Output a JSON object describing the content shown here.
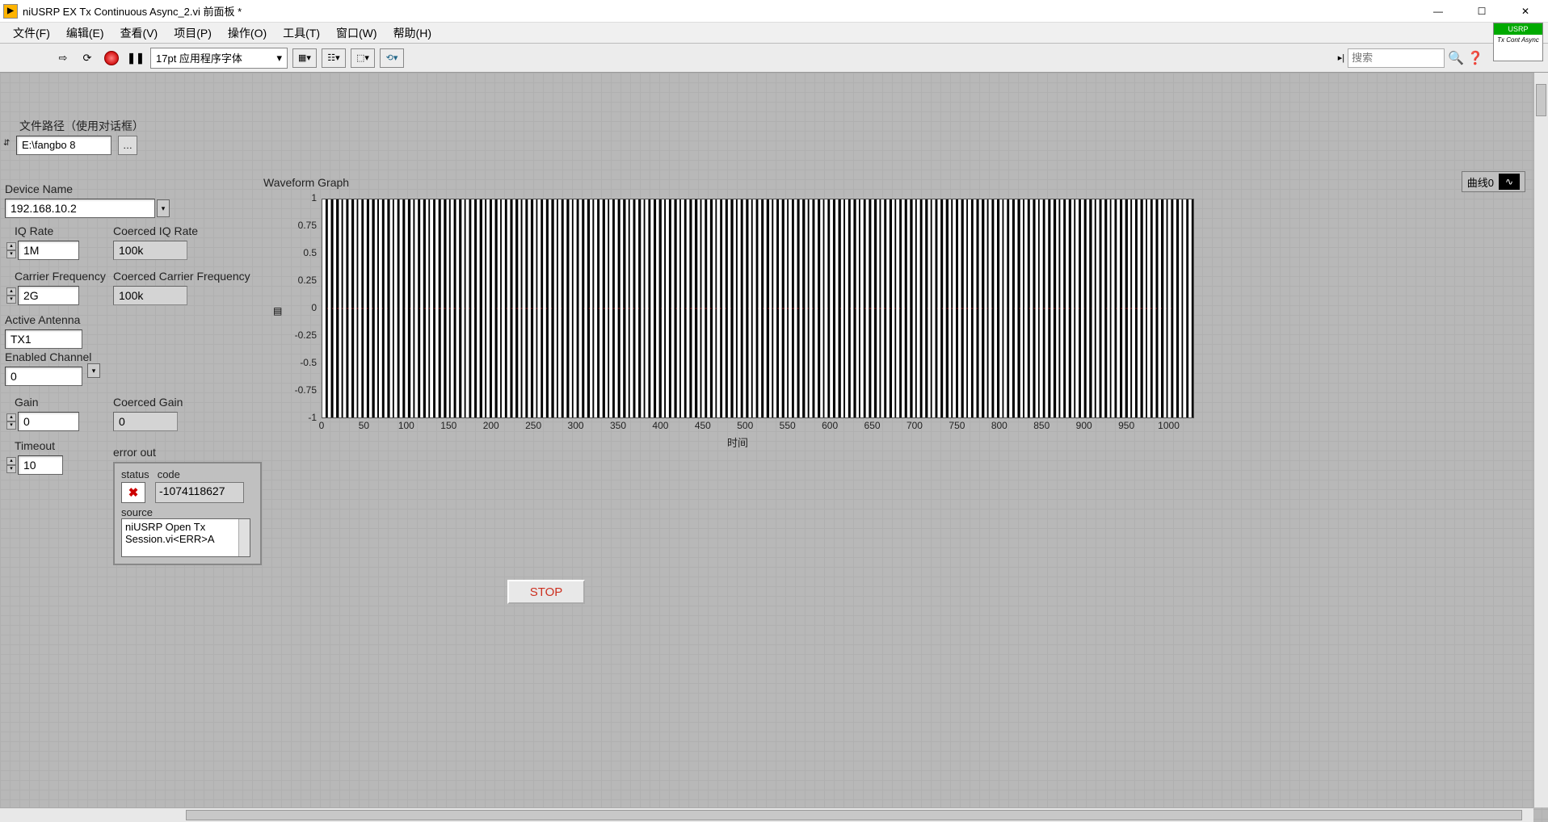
{
  "window": {
    "title": "niUSRP EX Tx Continuous Async_2.vi 前面板 *"
  },
  "menu": {
    "file": "文件(F)",
    "edit": "编辑(E)",
    "view": "查看(V)",
    "project": "项目(P)",
    "operate": "操作(O)",
    "tools": "工具(T)",
    "window": "窗口(W)",
    "help": "帮助(H)"
  },
  "toolbar": {
    "font": "17pt 应用程序字体",
    "search_placeholder": "搜索",
    "badge_top": "USRP",
    "badge_bot": "Tx\nCont\nAsync"
  },
  "controls": {
    "file_path_label": "文件路径（使用对话框）",
    "file_path_value": "E:\\fangbo 8",
    "device_name_label": "Device Name",
    "device_name_value": "192.168.10.2",
    "iq_rate_label": "IQ Rate",
    "iq_rate_value": "1M",
    "coerced_iq_rate_label": "Coerced IQ Rate",
    "coerced_iq_rate_value": "100k",
    "carrier_freq_label": "Carrier Frequency",
    "carrier_freq_value": "2G",
    "coerced_carrier_freq_label": "Coerced Carrier Frequency",
    "coerced_carrier_freq_value": "100k",
    "active_antenna_label": "Active Antenna",
    "active_antenna_value": "TX1",
    "enabled_channel_label": "Enabled Channel",
    "enabled_channel_value": "0",
    "gain_label": "Gain",
    "gain_value": "0",
    "coerced_gain_label": "Coerced Gain",
    "coerced_gain_value": "0",
    "timeout_label": "Timeout",
    "timeout_value": "10"
  },
  "error": {
    "cluster_label": "error out",
    "status_label": "status",
    "code_label": "code",
    "source_label": "source",
    "code_value": "-1074118627",
    "source_value": "niUSRP Open Tx Session.vi<ERR>A"
  },
  "stop_label": "STOP",
  "graph": {
    "title": "Waveform Graph",
    "legend_name": "曲线0",
    "xaxis_label": "时间"
  },
  "chart_data": {
    "type": "line",
    "title": "Waveform Graph",
    "xlabel": "时间",
    "ylabel": "",
    "ylim": [
      -1,
      1
    ],
    "xlim": [
      0,
      1030
    ],
    "y_ticks": [
      -1,
      -0.75,
      -0.5,
      -0.25,
      0,
      0.25,
      0.5,
      0.75,
      1
    ],
    "x_ticks": [
      0,
      50,
      100,
      150,
      200,
      250,
      300,
      350,
      400,
      450,
      500,
      550,
      600,
      650,
      700,
      750,
      800,
      850,
      900,
      950,
      1000
    ],
    "series": [
      {
        "name": "曲线0",
        "color": "#ffffff",
        "description": "square-like oscillation alternating near +1 and -1 across 0..1030 samples"
      }
    ]
  }
}
